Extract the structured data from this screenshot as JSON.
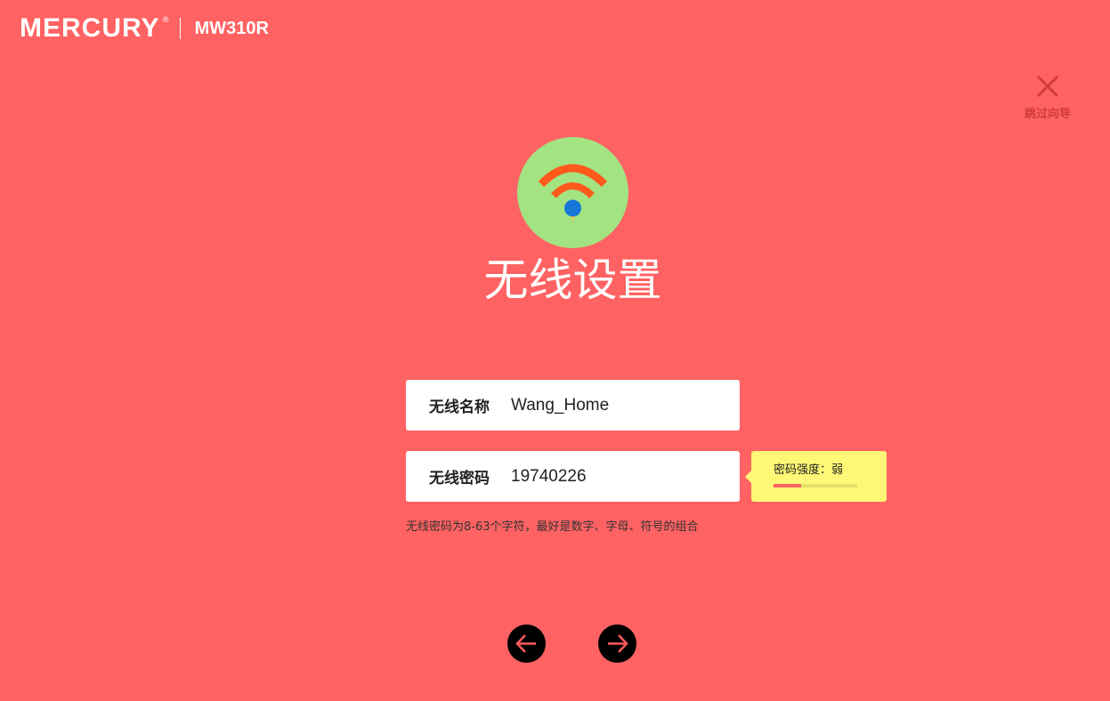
{
  "header": {
    "brand": "MERCURY",
    "registered_mark": "®",
    "model": "MW310R"
  },
  "skip": {
    "icon": "close-icon",
    "label": "跳过向导",
    "color": "#D13A3A"
  },
  "page": {
    "icon": "wifi-icon",
    "title": "无线设置",
    "background": "#FF6262",
    "badge_color": "#A3E381"
  },
  "form": {
    "ssid": {
      "label": "无线名称",
      "value": "Wang_Home"
    },
    "password": {
      "label": "无线密码",
      "value": "19740226"
    },
    "hint": "无线密码为8-63个字符，最好是数字、字母、符号的组合"
  },
  "strength": {
    "label": "密码强度：弱",
    "level": 0.33,
    "color": "#FF6262",
    "track_color": "#E2E06A",
    "background": "#FFF876"
  },
  "nav": {
    "prev_icon": "arrow-left-icon",
    "next_icon": "arrow-right-icon"
  }
}
